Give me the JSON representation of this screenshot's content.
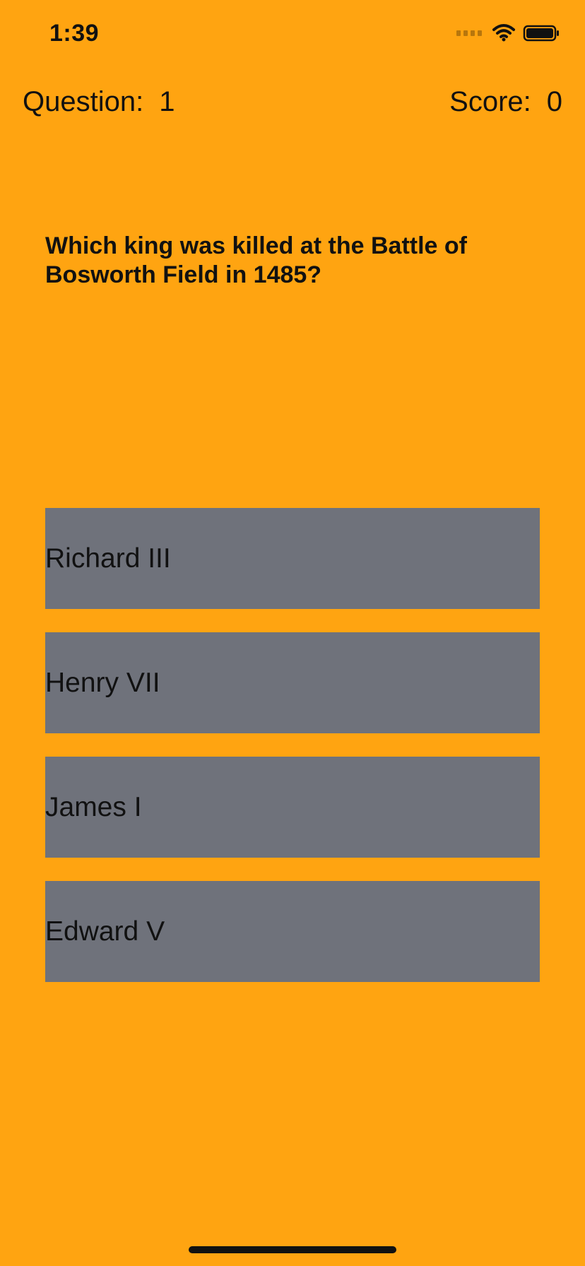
{
  "status_bar": {
    "time": "1:39",
    "icons": [
      "signal-icon",
      "wifi-icon",
      "battery-icon"
    ]
  },
  "top_info": {
    "question_label": "Question:",
    "question_number": "1",
    "score_label": "Score:",
    "score_value": "0"
  },
  "question": {
    "text": "Which king was killed at the Battle of Bosworth Field in 1485?"
  },
  "answers": [
    {
      "label": "Richard III"
    },
    {
      "label": "Henry VII"
    },
    {
      "label": "James I"
    },
    {
      "label": "Edward V"
    }
  ],
  "colors": {
    "background": "#ffa411",
    "answer_button": "#6f727b",
    "text": "#111111"
  }
}
